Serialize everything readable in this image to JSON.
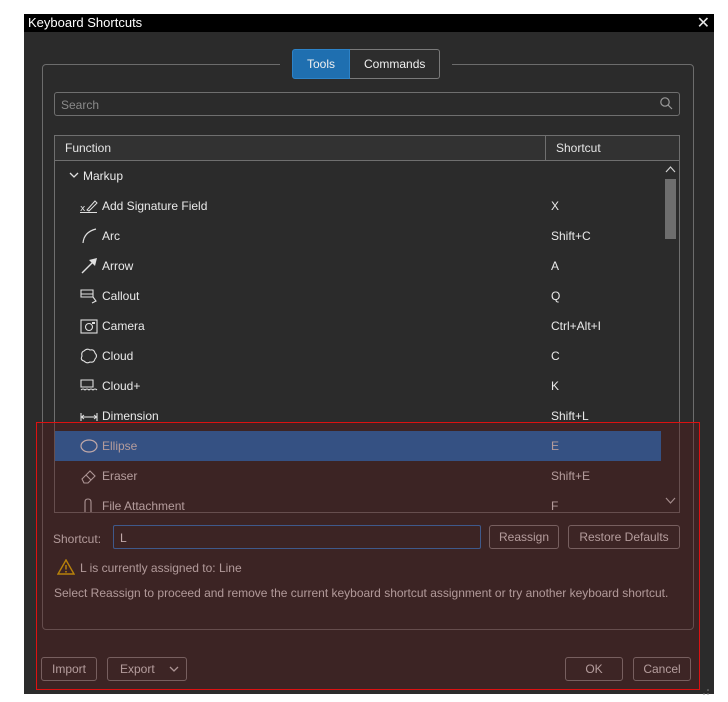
{
  "window": {
    "title": "Keyboard Shortcuts",
    "close_glyph": "✕"
  },
  "tabs": [
    {
      "label": "Tools",
      "active": true
    },
    {
      "label": "Commands",
      "active": false
    }
  ],
  "search": {
    "placeholder": "Search",
    "icon": "search-icon"
  },
  "table": {
    "columns": {
      "function": "Function",
      "shortcut": "Shortcut"
    },
    "group": {
      "label": "Markup",
      "expanded": true
    },
    "rows": [
      {
        "name": "Add Signature Field",
        "key": "X",
        "icon": "signature-icon"
      },
      {
        "name": "Arc",
        "key": "Shift+C",
        "icon": "arc-icon"
      },
      {
        "name": "Arrow",
        "key": "A",
        "icon": "arrow-icon"
      },
      {
        "name": "Callout",
        "key": "Q",
        "icon": "callout-icon"
      },
      {
        "name": "Camera",
        "key": "Ctrl+Alt+I",
        "icon": "camera-icon"
      },
      {
        "name": "Cloud",
        "key": "C",
        "icon": "cloud-icon"
      },
      {
        "name": "Cloud+",
        "key": "K",
        "icon": "cloud-plus-icon"
      },
      {
        "name": "Dimension",
        "key": "Shift+L",
        "icon": "dimension-icon"
      },
      {
        "name": "Ellipse",
        "key": "E",
        "icon": "ellipse-icon",
        "selected": true
      },
      {
        "name": "Eraser",
        "key": "Shift+E",
        "icon": "eraser-icon"
      },
      {
        "name": "File Attachment",
        "key": "F",
        "icon": "file-attachment-icon"
      }
    ]
  },
  "shortcut": {
    "label": "Shortcut:",
    "value": "L",
    "reassign_label": "Reassign",
    "restore_label": "Restore Defaults"
  },
  "warning": {
    "text": "L is currently assigned to: Line",
    "icon": "warning-icon",
    "color": "#f2c200"
  },
  "info": {
    "text": "Select Reassign to proceed and remove the current keyboard shortcut assignment or try another keyboard shortcut."
  },
  "footer": {
    "import_label": "Import",
    "export_label": "Export",
    "ok_label": "OK",
    "cancel_label": "Cancel"
  },
  "colors": {
    "accent": "#1f73c4",
    "background": "#2b2b2b",
    "highlight_border": "#dd1111"
  }
}
